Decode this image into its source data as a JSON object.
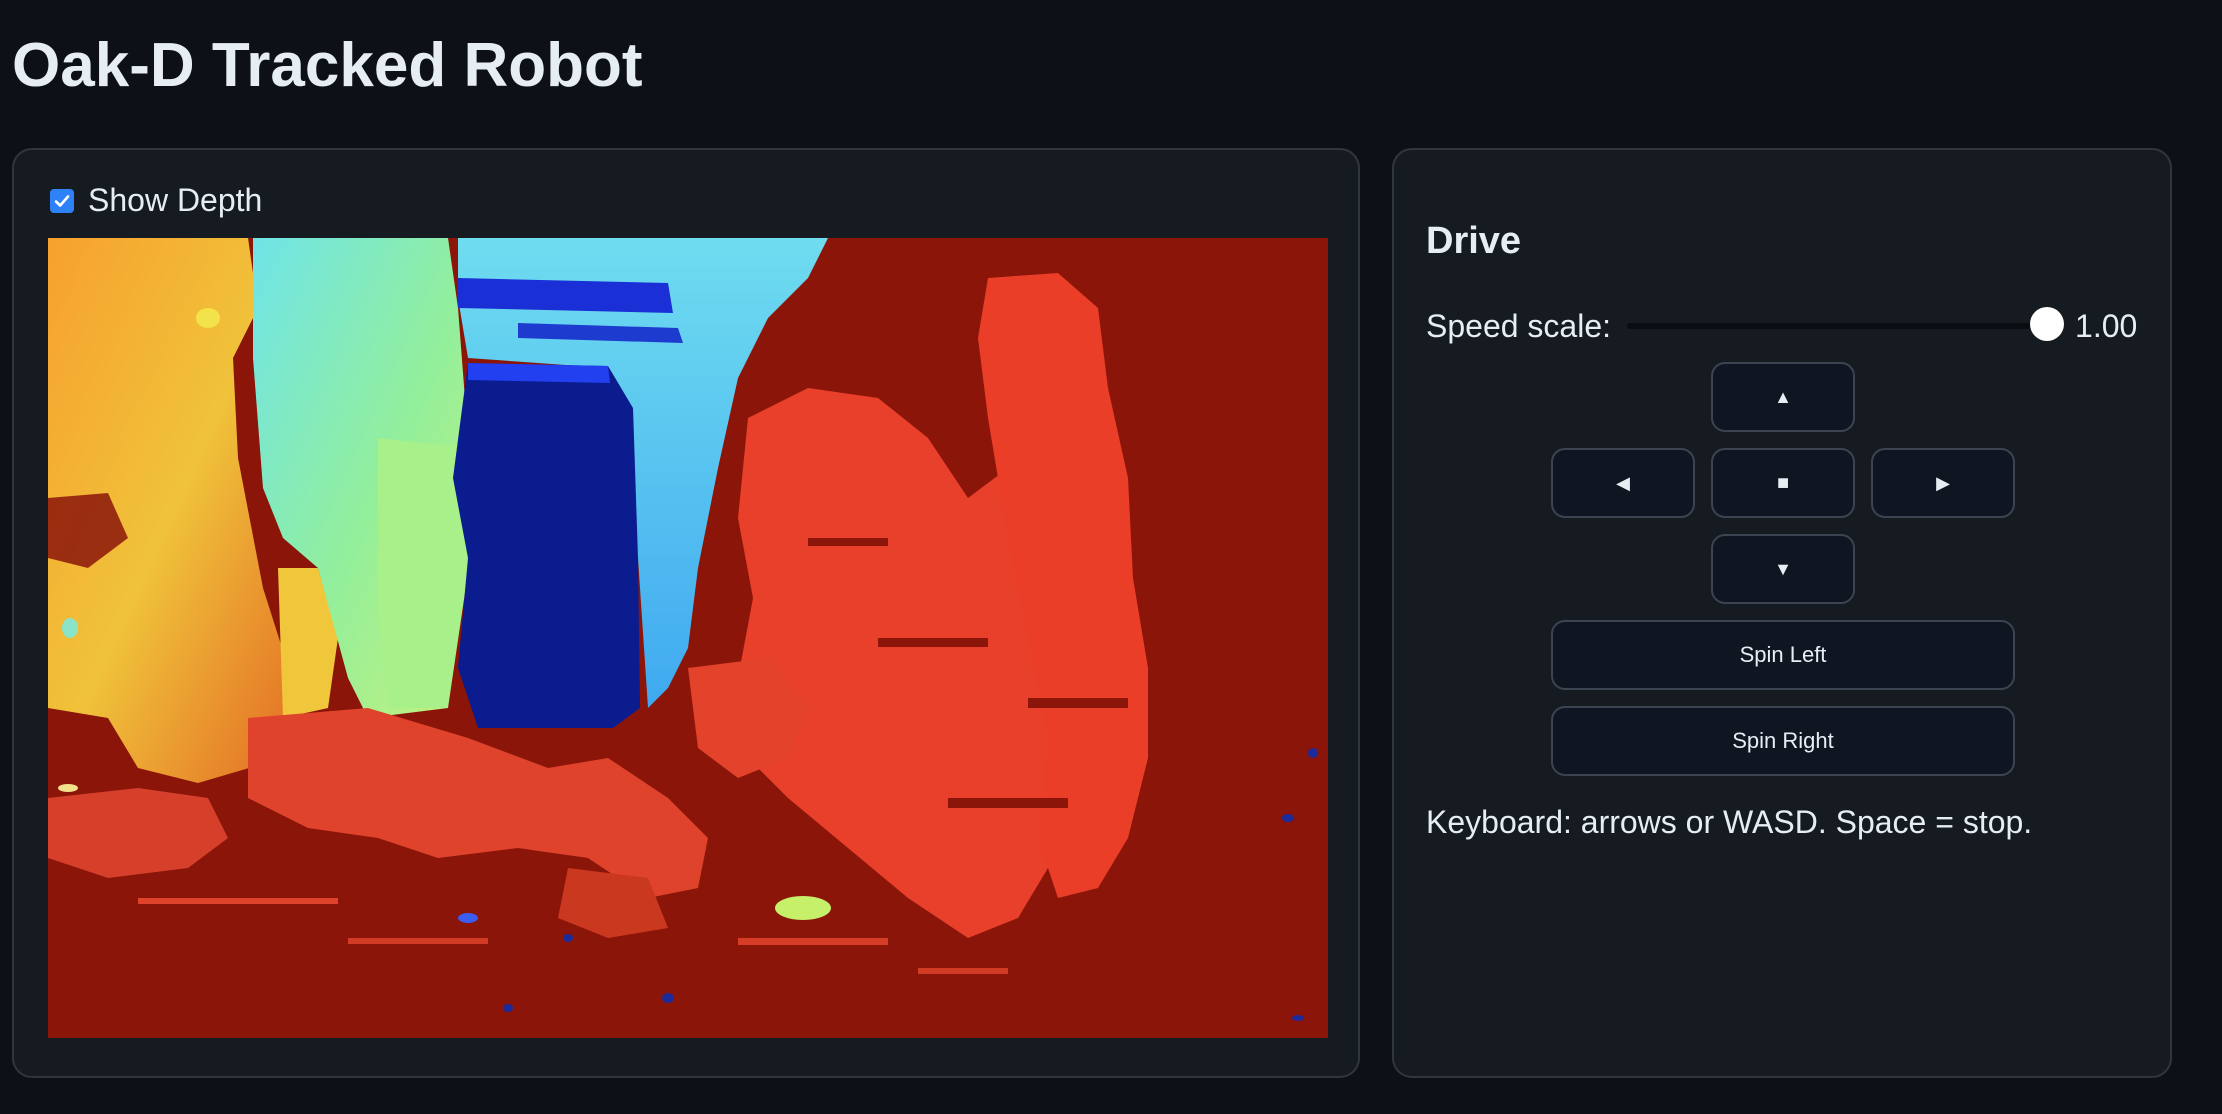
{
  "page": {
    "title": "Oak-D Tracked Robot"
  },
  "video": {
    "show_depth_label": "Show Depth",
    "show_depth_checked": true
  },
  "drive": {
    "title": "Drive",
    "speed_label": "Speed scale:",
    "speed_value": "1.00",
    "speed_fraction": 1.0,
    "buttons": {
      "up": "▲",
      "left": "◀",
      "stop": "■",
      "right": "▶",
      "down": "▼",
      "spin_left": "Spin Left",
      "spin_right": "Spin Right"
    },
    "keyboard_hint": "Keyboard: arrows or WASD. Space = stop."
  },
  "colors": {
    "background": "#0d1117",
    "panel": "#161b22",
    "accent": "#2f81f7"
  }
}
